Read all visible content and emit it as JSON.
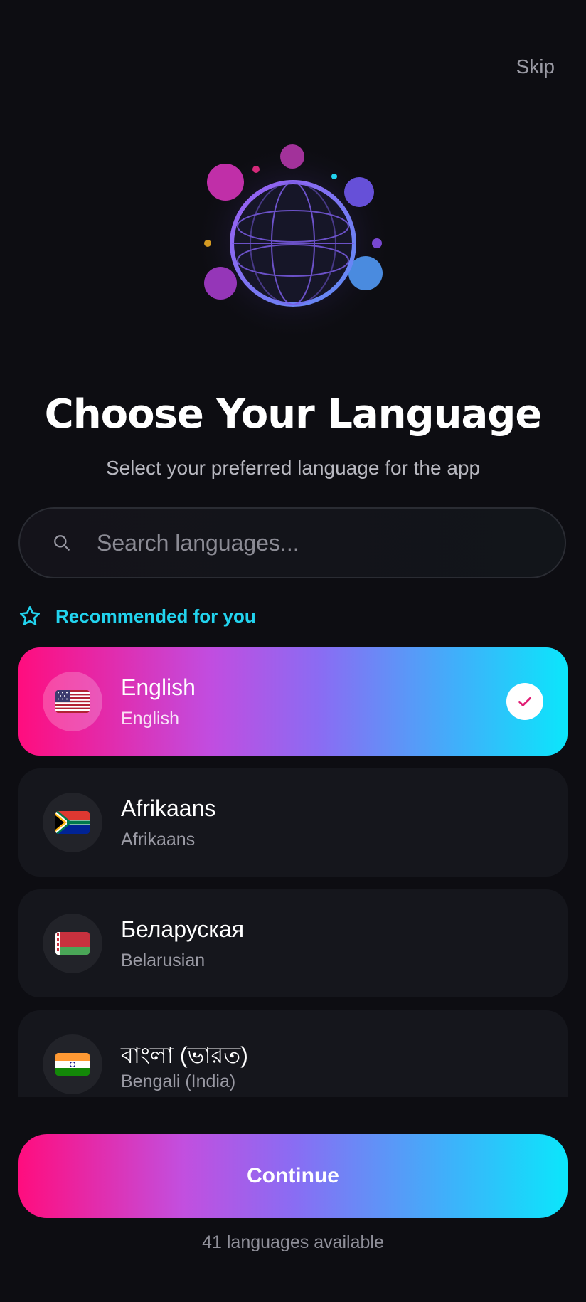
{
  "header": {
    "skip_label": "Skip"
  },
  "hero": {
    "icon": "globe-illustration"
  },
  "title": "Choose Your Language",
  "subtitle": "Select your preferred language for the app",
  "search": {
    "placeholder": "Search languages...",
    "value": ""
  },
  "recommended": {
    "label": "Recommended for you"
  },
  "languages": [
    {
      "name": "English",
      "native": "English",
      "flag": "flag-us",
      "selected": true
    },
    {
      "name": "Afrikaans",
      "native": "Afrikaans",
      "flag": "flag-za",
      "selected": false
    },
    {
      "name": "Беларуская",
      "native": "Belarusian",
      "flag": "flag-by",
      "selected": false
    },
    {
      "name": "বাংলা (ভারত)",
      "native": "Bengali (India)",
      "flag": "flag-in",
      "selected": false
    }
  ],
  "continue_label": "Continue",
  "footer": {
    "count_text": "41 languages available"
  },
  "colors": {
    "background": "#0d0d12",
    "accent_cyan": "#22d3ee",
    "gradient_start": "#ff0d7e",
    "gradient_mid": "#8a6cf3",
    "gradient_end": "#0be6fb"
  }
}
